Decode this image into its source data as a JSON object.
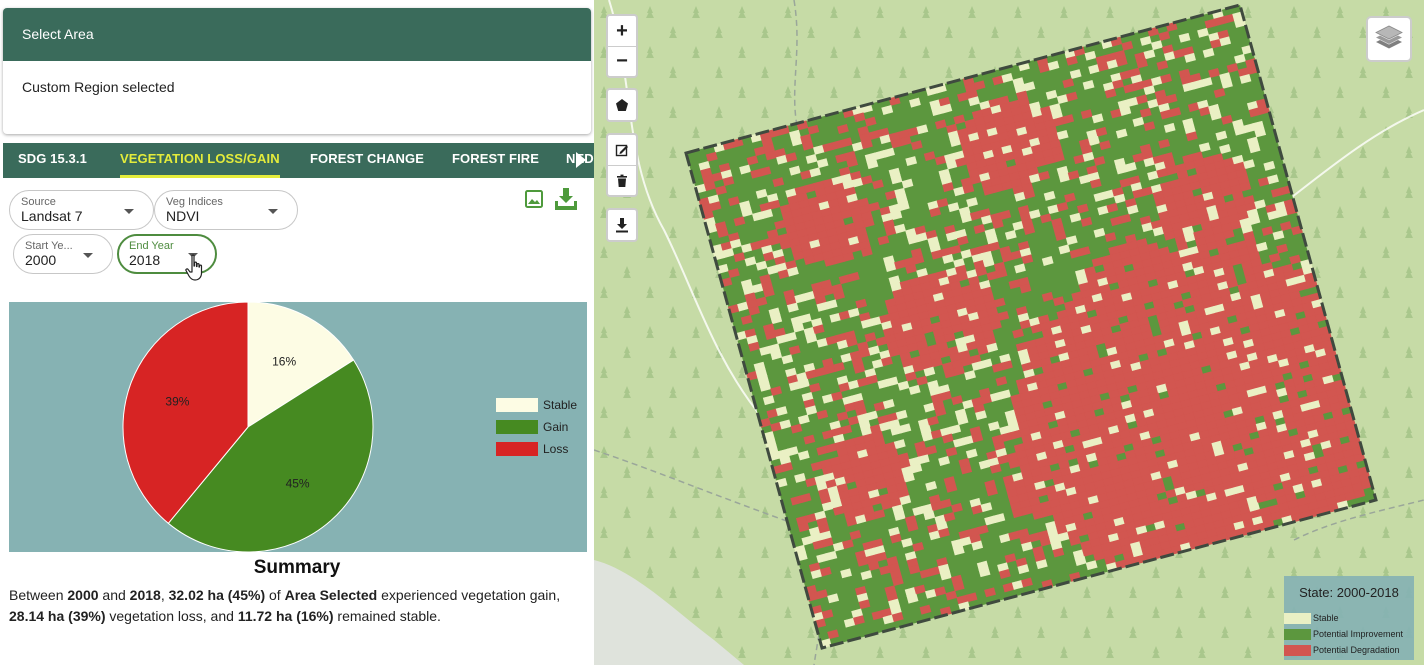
{
  "select_area": {
    "title": "Select Area",
    "status": "Custom Region selected"
  },
  "tabs": [
    {
      "label": "SDG 15.3.1",
      "active": false
    },
    {
      "label": "VEGETATION LOSS/GAIN",
      "active": true
    },
    {
      "label": "FOREST CHANGE",
      "active": false
    },
    {
      "label": "FOREST FIRE",
      "active": false
    },
    {
      "label": "NED",
      "active": false
    }
  ],
  "controls": {
    "source": {
      "label": "Source",
      "value": "Landsat 7"
    },
    "veg_indices": {
      "label": "Veg Indices",
      "value": "NDVI"
    },
    "start_year": {
      "label": "Start Ye...",
      "value": "2000"
    },
    "end_year": {
      "label": "End Year",
      "value": "2018"
    },
    "image_icon": "image-icon",
    "download_icon": "download-icon"
  },
  "colors": {
    "header": "#3a6b5b",
    "active_tab": "#e4ec3b",
    "stable": "#fdfce4",
    "gain": "#468a21",
    "loss": "#d72424",
    "map_stable": "#eaf0c4",
    "map_improvement": "#5c973e",
    "map_degradation": "#d25650"
  },
  "chart_data": {
    "type": "pie",
    "slices": [
      {
        "name": "Stable",
        "value": 16,
        "label": "16%"
      },
      {
        "name": "Gain",
        "value": 45,
        "label": "45%"
      },
      {
        "name": "Loss",
        "value": 39,
        "label": "39%"
      }
    ],
    "legend": [
      "Stable",
      "Gain",
      "Loss"
    ],
    "legend_position": "right"
  },
  "summary": {
    "title": "Summary",
    "p1": "Between ",
    "start": "2000",
    "p2": " and ",
    "end": "2018",
    "p3": ", ",
    "gain": "32.02 ha (45%)",
    "p4": " of ",
    "area": "Area Selected",
    "p5": " experienced vegetation gain, ",
    "loss": "28.14 ha (39%)",
    "p6": " vegetation loss, and ",
    "stable": "11.72 ha (16%)",
    "p7": " remained stable."
  },
  "map": {
    "zoom_in": "+",
    "zoom_out": "−",
    "tools": [
      "polygon-icon",
      "edit-icon",
      "trash-icon",
      "download-icon"
    ],
    "layers_icon": "layers-icon",
    "legend_title": "State: 2000-2018",
    "legend_items": [
      {
        "label": "Stable"
      },
      {
        "label": "Potential Improvement"
      },
      {
        "label": "Potential Degradation"
      }
    ]
  }
}
